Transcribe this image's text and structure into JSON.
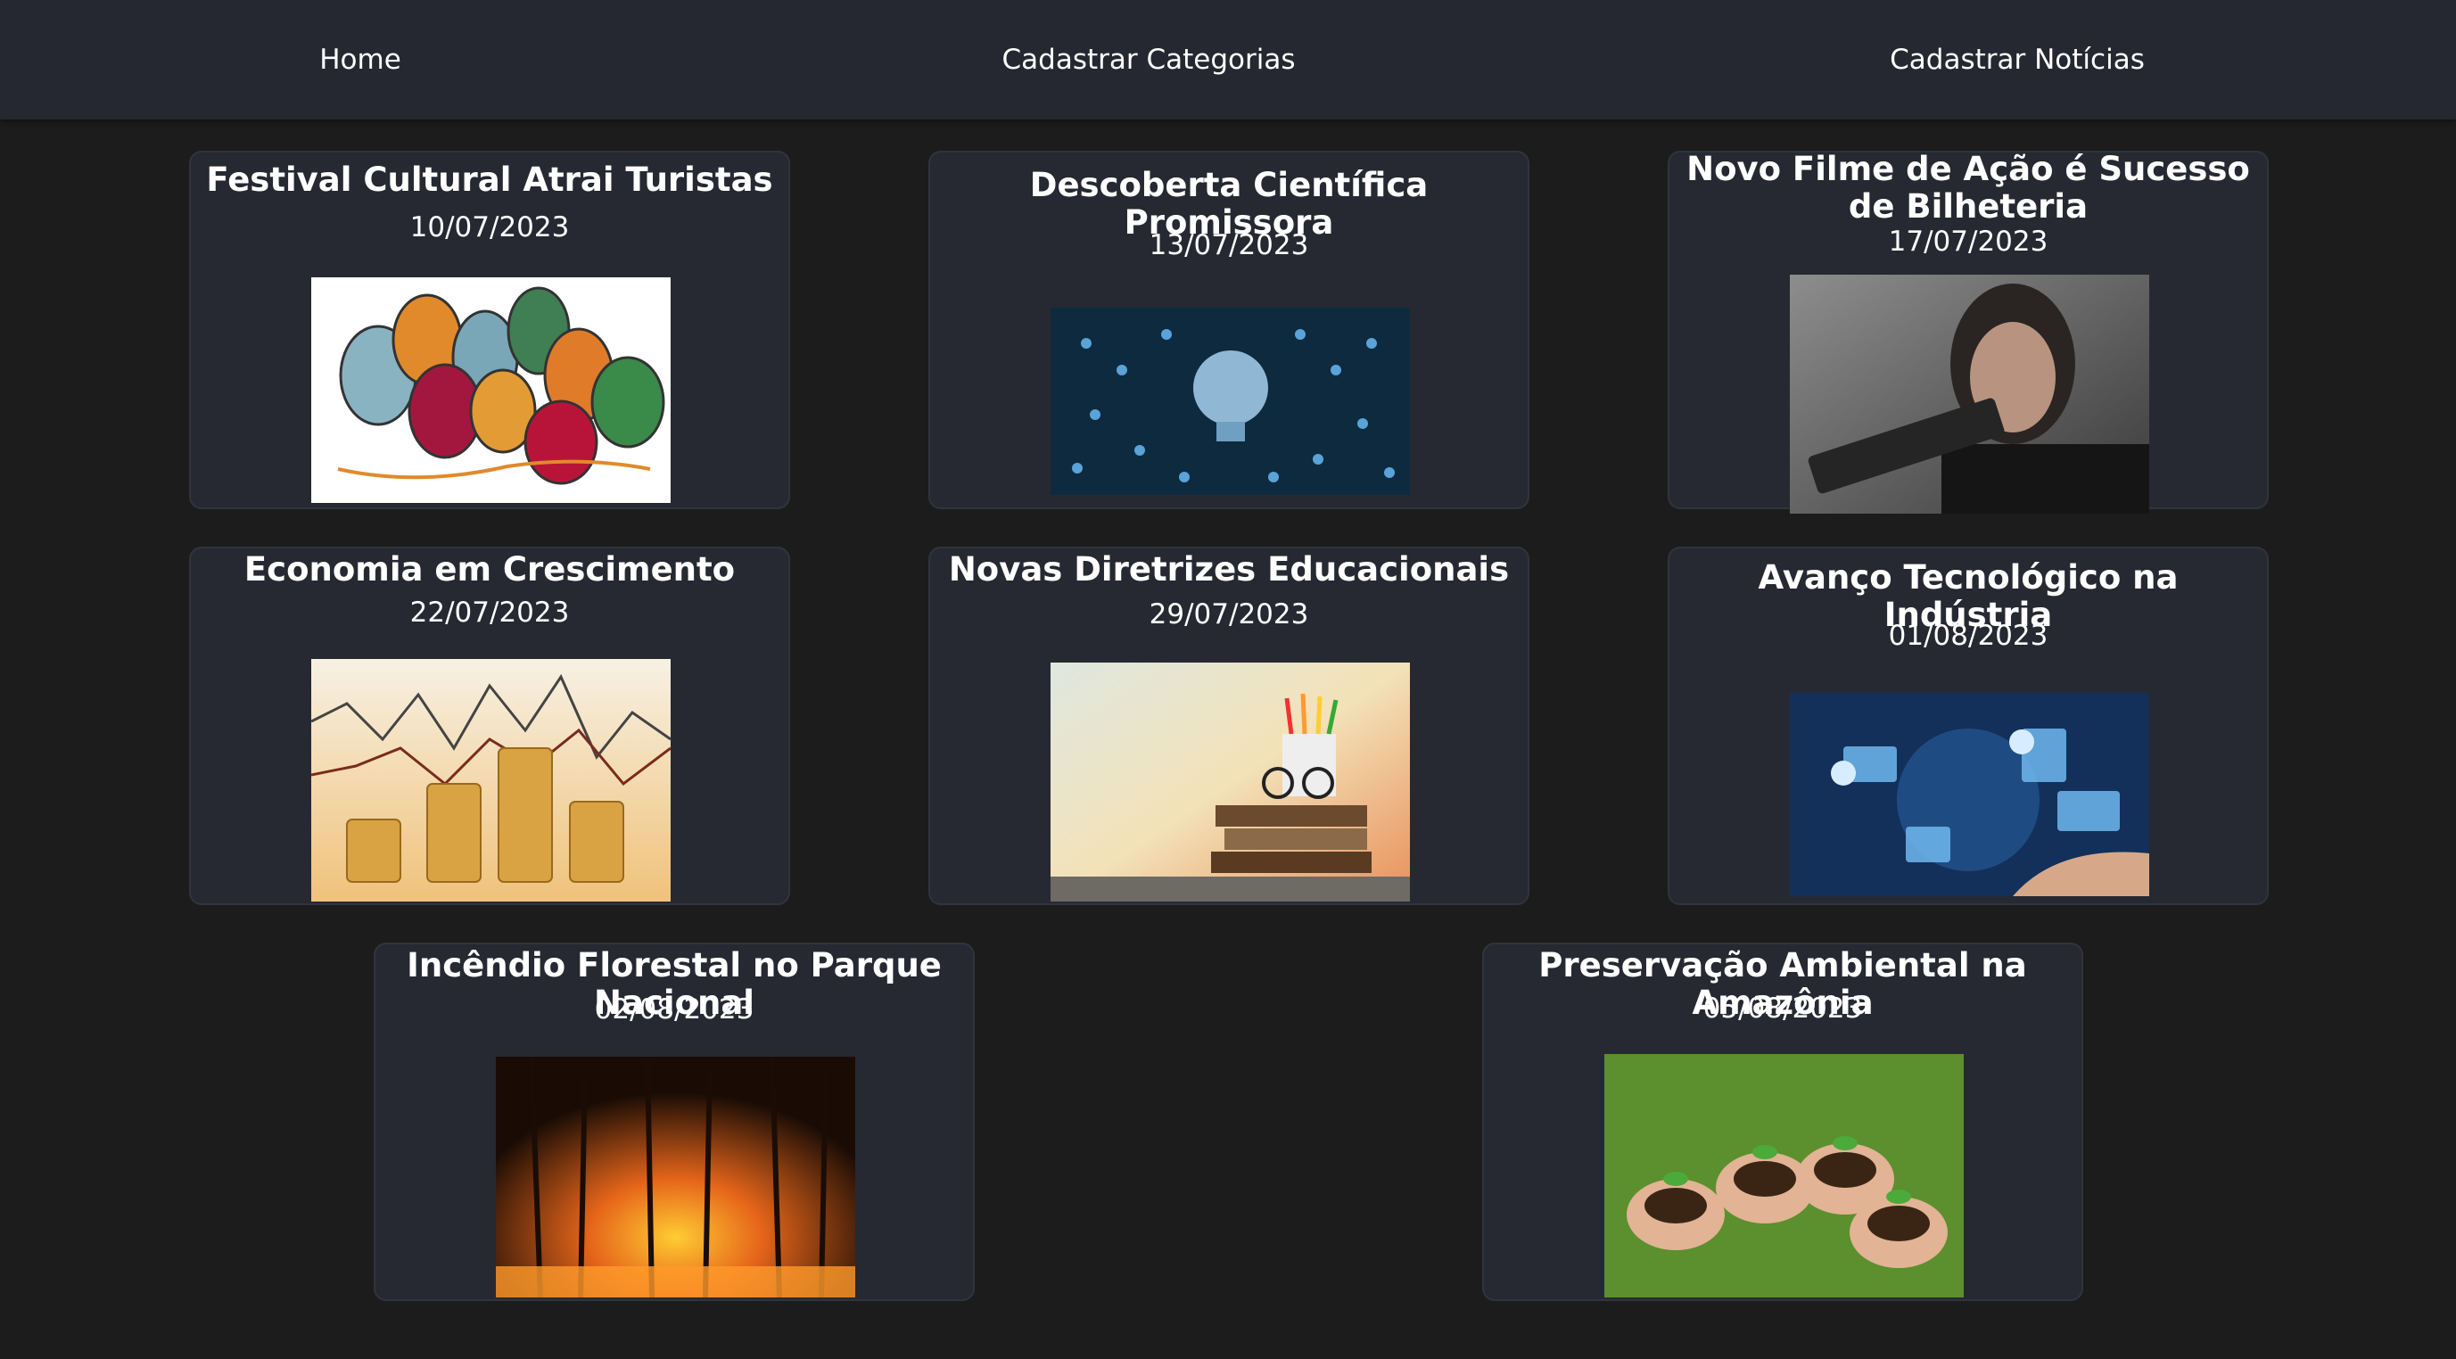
{
  "nav": {
    "home": "Home",
    "categories": "Cadastrar Categorias",
    "news": "Cadastrar Notícias"
  },
  "news": [
    {
      "title": "Festival Cultural Atrai Turistas",
      "date": "10/07/2023",
      "image": "festival-faces-image"
    },
    {
      "title": "Descoberta Científica Promissora",
      "date": "13/07/2023",
      "image": "science-lightbulb-image"
    },
    {
      "title": "Novo Filme de Ação é Sucesso de Bilheteria",
      "date": "17/07/2023",
      "image": "action-movie-still-image"
    },
    {
      "title": "Economia em Crescimento",
      "date": "22/07/2023",
      "image": "coins-chart-image"
    },
    {
      "title": "Novas Diretrizes Educacionais",
      "date": "29/07/2023",
      "image": "books-pencils-image"
    },
    {
      "title": "Avanço Tecnológico na Indústria",
      "date": "01/08/2023",
      "image": "tech-hand-image"
    },
    {
      "title": "Incêndio Florestal no Parque Nacional",
      "date": "02/08/2023",
      "image": "forest-fire-image"
    },
    {
      "title": "Preservação Ambiental na Amazônia",
      "date": "05/08/2023",
      "image": "hands-seedlings-image"
    }
  ]
}
